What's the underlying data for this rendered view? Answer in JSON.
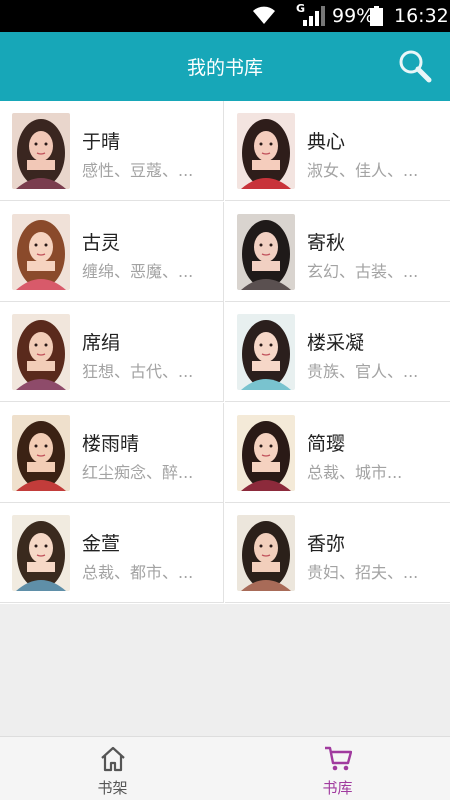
{
  "status_bar": {
    "network_type": "G",
    "battery_percent": "99%",
    "time": "16:32",
    "icons": [
      "wifi-icon",
      "signal-icon",
      "battery-icon"
    ]
  },
  "app_bar": {
    "title": "我的书库",
    "search_icon": "search-icon"
  },
  "books": [
    {
      "name": "于晴",
      "tags": "感性、豆蔻、...",
      "palette": [
        "#e9d6cc",
        "#3a2620",
        "#f2c8b7",
        "#7a3d4e"
      ]
    },
    {
      "name": "典心",
      "tags": "淑女、佳人、...",
      "palette": [
        "#f3e4e0",
        "#2e1d1a",
        "#f5cdbd",
        "#c8333a"
      ]
    },
    {
      "name": "古灵",
      "tags": "缠绵、恶魔、...",
      "palette": [
        "#f0e1d8",
        "#8a4a2b",
        "#f6d3c0",
        "#d85a6a"
      ]
    },
    {
      "name": "寄秋",
      "tags": "玄幻、古装、...",
      "palette": [
        "#d9d4cf",
        "#1f1a19",
        "#f1d0c2",
        "#5a5050"
      ]
    },
    {
      "name": "席绢",
      "tags": "狂想、古代、...",
      "palette": [
        "#f1e6dc",
        "#5a2a1c",
        "#f2cdb8",
        "#8e4b6a"
      ]
    },
    {
      "name": "楼采凝",
      "tags": "贵族、官人、...",
      "palette": [
        "#e8f0f0",
        "#2b1f1d",
        "#f6d7c8",
        "#79c3cf"
      ]
    },
    {
      "name": "楼雨晴",
      "tags": "红尘痴念、醉...",
      "palette": [
        "#efe0cc",
        "#3b2214",
        "#f3cdb5",
        "#c23c3a"
      ]
    },
    {
      "name": "简璎",
      "tags": "总裁、城市...",
      "palette": [
        "#f4ead8",
        "#2a1a16",
        "#f5d2c0",
        "#8c2a3b"
      ]
    },
    {
      "name": "金萱",
      "tags": "总裁、都市、...",
      "palette": [
        "#f1ebe0",
        "#3a2a1e",
        "#f6d8c6",
        "#5f8fa8"
      ]
    },
    {
      "name": "香弥",
      "tags": "贵妇、招夫、...",
      "palette": [
        "#ece6dc",
        "#2b201a",
        "#f2cfbc",
        "#a86b58"
      ]
    }
  ],
  "bottom_nav": [
    {
      "label": "书架",
      "icon": "home-icon",
      "active": false,
      "color": "#555555"
    },
    {
      "label": "书库",
      "icon": "cart-icon",
      "active": true,
      "color": "#a03a9e"
    }
  ]
}
